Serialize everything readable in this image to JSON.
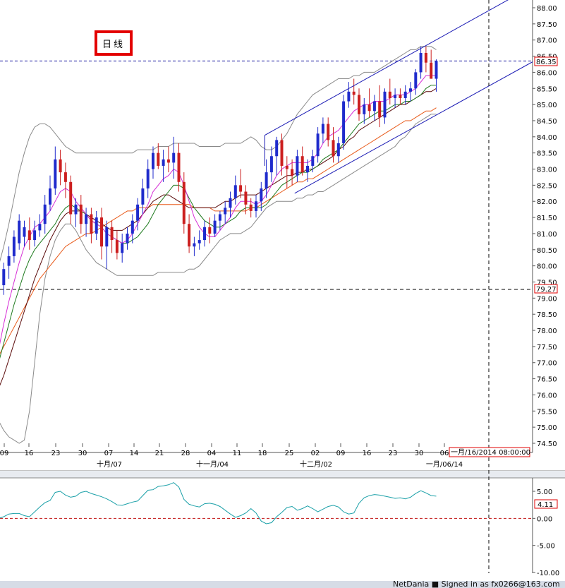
{
  "chart_title": "日线",
  "price_ref_label": "86.35",
  "low_ref_label": "79.27",
  "osc_value_label": "4.11",
  "crosshair_date_label": "一月/16/2014 08:00:00",
  "status_text": "NetDania ■  Signed in as fx0266@163.com",
  "colors": {
    "bull_candle": "#1f2bcc",
    "bear_candle": "#cc1f1f",
    "bollinger": "#8a8a8a",
    "ma_pink": "#d62cd6",
    "ma_green": "#1e7a1e",
    "ma_brown": "#5a0a0a",
    "ma_orange": "#e85a1a",
    "channel": "#1a1ab4",
    "oscillator": "#1aa0a8",
    "crosshair": "#1a1aa0"
  },
  "chart_data": {
    "type": "candlestick",
    "y_axis": {
      "min": 74.5,
      "max": 88.0,
      "ticks": [
        "88.00",
        "87.50",
        "87.00",
        "86.50",
        "86.00",
        "85.50",
        "85.00",
        "84.50",
        "84.00",
        "83.50",
        "83.00",
        "82.50",
        "82.00",
        "81.50",
        "81.00",
        "80.50",
        "80.00",
        "79.50",
        "79.00",
        "78.50",
        "78.00",
        "77.50",
        "77.00",
        "76.50",
        "76.00",
        "75.50",
        "75.00",
        "74.50"
      ]
    },
    "x_axis": {
      "day_ticks": [
        "09",
        "16",
        "23",
        "30",
        "07",
        "14",
        "21",
        "28",
        "04",
        "11",
        "18",
        "25",
        "02",
        "09",
        "16",
        "23",
        "30",
        "06"
      ],
      "month_labels": [
        "十月/07",
        "十一月/04",
        "十二月/02",
        "一月/06/14"
      ]
    },
    "candles": [
      [
        79.2,
        79.6,
        78.7,
        79.0
      ],
      [
        79.4,
        80.1,
        79.1,
        79.9
      ],
      [
        80.0,
        80.6,
        79.6,
        80.3
      ],
      [
        80.3,
        81.1,
        80.1,
        80.9
      ],
      [
        80.7,
        81.6,
        80.5,
        81.4
      ],
      [
        80.9,
        81.4,
        80.6,
        81.2
      ],
      [
        81.1,
        81.5,
        80.5,
        80.8
      ],
      [
        80.8,
        81.4,
        80.6,
        81.1
      ],
      [
        81.1,
        81.6,
        80.9,
        81.3
      ],
      [
        81.3,
        82.2,
        81.0,
        81.9
      ],
      [
        81.9,
        82.8,
        81.7,
        82.4
      ],
      [
        82.4,
        83.7,
        82.2,
        83.3
      ],
      [
        83.3,
        83.6,
        82.5,
        82.9
      ],
      [
        82.9,
        83.2,
        82.1,
        82.6
      ],
      [
        82.6,
        82.8,
        81.3,
        81.6
      ],
      [
        81.6,
        82.1,
        81.2,
        81.9
      ],
      [
        81.9,
        82.2,
        81.0,
        81.3
      ],
      [
        81.3,
        81.8,
        80.9,
        81.6
      ],
      [
        81.6,
        81.8,
        80.7,
        81.0
      ],
      [
        81.0,
        81.7,
        80.8,
        81.5
      ],
      [
        81.5,
        81.8,
        80.2,
        80.6
      ],
      [
        80.6,
        81.4,
        79.9,
        81.2
      ],
      [
        81.2,
        81.4,
        80.4,
        80.8
      ],
      [
        80.8,
        81.1,
        80.2,
        80.4
      ],
      [
        80.4,
        81.0,
        80.1,
        80.7
      ],
      [
        80.7,
        81.2,
        80.5,
        81.0
      ],
      [
        81.0,
        81.6,
        80.7,
        81.4
      ],
      [
        81.4,
        82.1,
        81.1,
        81.9
      ],
      [
        81.9,
        82.7,
        81.6,
        82.4
      ],
      [
        82.4,
        83.3,
        82.1,
        83.0
      ],
      [
        83.0,
        83.7,
        82.7,
        83.5
      ],
      [
        83.5,
        83.8,
        83.0,
        83.1
      ],
      [
        83.1,
        83.6,
        82.6,
        83.3
      ],
      [
        83.3,
        83.7,
        82.9,
        83.2
      ],
      [
        83.2,
        84.0,
        82.7,
        83.5
      ],
      [
        83.5,
        83.8,
        82.3,
        82.6
      ],
      [
        82.6,
        82.9,
        81.0,
        81.3
      ],
      [
        81.3,
        81.6,
        80.4,
        80.6
      ],
      [
        80.6,
        80.9,
        80.3,
        80.7
      ],
      [
        80.7,
        81.1,
        80.5,
        80.8
      ],
      [
        80.8,
        81.4,
        80.6,
        81.2
      ],
      [
        81.2,
        81.5,
        80.7,
        81.0
      ],
      [
        81.0,
        81.6,
        80.9,
        81.4
      ],
      [
        81.4,
        81.7,
        81.1,
        81.6
      ],
      [
        81.6,
        82.0,
        81.3,
        81.8
      ],
      [
        81.8,
        82.3,
        81.5,
        82.1
      ],
      [
        82.1,
        82.8,
        81.9,
        82.5
      ],
      [
        82.5,
        83.0,
        82.1,
        82.3
      ],
      [
        82.3,
        82.5,
        81.6,
        81.9
      ],
      [
        81.9,
        82.1,
        81.5,
        81.7
      ],
      [
        81.7,
        82.2,
        81.5,
        82.0
      ],
      [
        82.0,
        82.6,
        81.7,
        82.4
      ],
      [
        82.4,
        83.3,
        82.1,
        82.9
      ],
      [
        82.9,
        83.7,
        82.6,
        83.4
      ],
      [
        83.4,
        84.0,
        82.8,
        83.9
      ],
      [
        83.9,
        84.1,
        82.8,
        83.1
      ],
      [
        83.1,
        83.4,
        82.4,
        83.0
      ],
      [
        83.0,
        83.3,
        82.5,
        82.8
      ],
      [
        82.8,
        83.6,
        82.6,
        83.4
      ],
      [
        83.4,
        83.7,
        82.8,
        82.9
      ],
      [
        82.9,
        83.3,
        82.6,
        83.1
      ],
      [
        83.1,
        83.6,
        82.9,
        83.4
      ],
      [
        83.4,
        84.3,
        83.2,
        84.1
      ],
      [
        84.1,
        84.6,
        83.8,
        84.4
      ],
      [
        84.4,
        84.6,
        83.7,
        83.9
      ],
      [
        83.9,
        84.3,
        83.2,
        83.4
      ],
      [
        83.4,
        84.0,
        83.2,
        83.8
      ],
      [
        83.8,
        85.3,
        83.6,
        85.1
      ],
      [
        85.1,
        85.7,
        84.9,
        85.4
      ],
      [
        85.4,
        85.8,
        85.0,
        85.3
      ],
      [
        85.3,
        85.5,
        84.5,
        84.7
      ],
      [
        84.7,
        85.2,
        84.4,
        85.0
      ],
      [
        85.0,
        85.5,
        84.6,
        84.8
      ],
      [
        84.8,
        85.3,
        84.5,
        85.1
      ],
      [
        85.1,
        85.6,
        84.3,
        84.6
      ],
      [
        84.6,
        85.5,
        84.4,
        85.4
      ],
      [
        85.4,
        85.8,
        85.0,
        85.2
      ],
      [
        85.2,
        85.5,
        84.9,
        85.3
      ],
      [
        85.3,
        85.5,
        85.0,
        85.2
      ],
      [
        85.2,
        85.6,
        85.0,
        85.4
      ],
      [
        85.4,
        85.7,
        85.1,
        85.5
      ],
      [
        85.5,
        86.1,
        85.3,
        86.0
      ],
      [
        86.0,
        86.8,
        85.8,
        86.6
      ],
      [
        86.6,
        86.8,
        86.0,
        86.3
      ],
      [
        86.3,
        86.7,
        85.8,
        85.8
      ],
      [
        85.8,
        86.4,
        85.4,
        86.35
      ]
    ],
    "ma_pink": [
      77.4,
      78.2,
      78.9,
      79.5,
      80.1,
      80.6,
      80.9,
      81.2,
      81.3,
      81.5,
      81.7,
      82.0,
      82.3,
      82.4,
      82.3,
      82.0,
      81.8,
      81.6,
      81.4,
      81.3,
      81.2,
      81.0,
      80.9,
      80.8,
      80.7,
      80.8,
      81.0,
      81.3,
      81.6,
      81.9,
      82.3,
      82.5,
      82.7,
      82.8,
      83.0,
      82.9,
      82.5,
      82.0,
      81.5,
      81.2,
      81.0,
      80.9,
      80.9,
      81.1,
      81.3,
      81.5,
      81.8,
      82.0,
      82.0,
      82.0,
      81.9,
      82.0,
      82.2,
      82.5,
      82.8,
      83.0,
      83.1,
      83.2,
      83.2,
      83.2,
      83.2,
      83.3,
      83.5,
      83.8,
      84.0,
      84.1,
      84.2,
      84.4,
      84.6,
      84.8,
      84.9,
      85.0,
      85.0,
      85.1,
      85.1,
      85.1,
      85.2,
      85.3,
      85.3,
      85.3,
      85.4,
      85.5,
      85.7,
      85.9,
      85.9,
      85.9
    ],
    "ma_green": [
      77.0,
      77.6,
      78.2,
      78.8,
      79.3,
      79.8,
      80.2,
      80.5,
      80.7,
      80.9,
      81.1,
      81.3,
      81.6,
      81.8,
      81.9,
      81.8,
      81.7,
      81.6,
      81.4,
      81.3,
      81.2,
      81.0,
      80.9,
      80.8,
      80.7,
      80.7,
      80.8,
      80.9,
      81.1,
      81.3,
      81.6,
      81.9,
      82.1,
      82.3,
      82.5,
      82.5,
      82.4,
      82.1,
      81.8,
      81.6,
      81.4,
      81.3,
      81.2,
      81.2,
      81.3,
      81.4,
      81.5,
      81.7,
      81.8,
      81.8,
      81.8,
      81.8,
      81.9,
      82.1,
      82.3,
      82.5,
      82.6,
      82.7,
      82.8,
      82.9,
      82.9,
      83.0,
      83.1,
      83.3,
      83.4,
      83.5,
      83.6,
      83.8,
      84.0,
      84.2,
      84.4,
      84.5,
      84.6,
      84.7,
      84.8,
      84.8,
      84.9,
      85.0,
      85.0,
      85.1,
      85.1,
      85.2,
      85.3,
      85.5,
      85.6,
      85.6
    ],
    "ma_brown": [
      76.2,
      76.6,
      77.1,
      77.6,
      78.1,
      78.6,
      79.1,
      79.6,
      80.0,
      80.4,
      80.8,
      81.1,
      81.4,
      81.6,
      81.7,
      81.7,
      81.7,
      81.6,
      81.5,
      81.4,
      81.3,
      81.2,
      81.1,
      81.1,
      81.1,
      81.2,
      81.3,
      81.4,
      81.6,
      81.8,
      82.0,
      82.1,
      82.2,
      82.2,
      82.1,
      82.0,
      81.9,
      81.8,
      81.8,
      81.8,
      81.8,
      81.8,
      81.8,
      81.9,
      82.0,
      82.0,
      82.1,
      82.2,
      82.2,
      82.2,
      82.2,
      82.3,
      82.4,
      82.5,
      82.6,
      82.7,
      82.8,
      82.8,
      82.9,
      82.9,
      83.0,
      83.0,
      83.1,
      83.2,
      83.3,
      83.4,
      83.6,
      83.7,
      83.9,
      84.0,
      84.2,
      84.3,
      84.4,
      84.5,
      84.6,
      84.7,
      84.8,
      84.9,
      85.0,
      85.0,
      85.1,
      85.2,
      85.3,
      85.4,
      85.4,
      85.5
    ],
    "ma_orange": [
      77.2,
      77.5,
      77.8,
      78.1,
      78.4,
      78.7,
      79.0,
      79.3,
      79.6,
      79.8,
      80.0,
      80.2,
      80.4,
      80.6,
      80.7,
      80.8,
      80.9,
      81.0,
      81.0,
      81.1,
      81.2,
      81.3,
      81.4,
      81.5,
      81.6,
      81.7,
      81.7,
      81.8,
      81.8,
      81.8,
      81.9,
      81.9,
      81.9,
      81.9,
      81.9,
      81.9,
      81.9,
      81.9,
      81.8,
      81.8,
      81.8,
      81.8,
      81.7,
      81.7,
      81.7,
      81.7,
      81.7,
      81.7,
      81.7,
      81.8,
      81.8,
      81.9,
      82.0,
      82.1,
      82.2,
      82.3,
      82.4,
      82.5,
      82.6,
      82.6,
      82.7,
      82.7,
      82.8,
      82.9,
      83.0,
      83.1,
      83.2,
      83.3,
      83.4,
      83.5,
      83.6,
      83.7,
      83.8,
      83.9,
      84.0,
      84.1,
      84.2,
      84.3,
      84.4,
      84.5,
      84.5,
      84.6,
      84.7,
      84.8,
      84.8,
      84.9
    ],
    "bb_upper": [
      80.0,
      80.6,
      81.3,
      82.1,
      82.9,
      83.5,
      84.0,
      84.3,
      84.4,
      84.4,
      84.3,
      84.1,
      83.9,
      83.7,
      83.6,
      83.5,
      83.5,
      83.5,
      83.5,
      83.5,
      83.5,
      83.5,
      83.5,
      83.5,
      83.5,
      83.5,
      83.5,
      83.6,
      83.6,
      83.6,
      83.6,
      83.7,
      83.7,
      83.7,
      83.8,
      83.8,
      83.8,
      83.8,
      83.8,
      83.7,
      83.7,
      83.7,
      83.7,
      83.7,
      83.8,
      83.8,
      83.8,
      83.8,
      83.9,
      84.0,
      83.9,
      83.7,
      83.6,
      83.6,
      83.7,
      83.9,
      84.1,
      84.4,
      84.7,
      84.9,
      85.1,
      85.3,
      85.4,
      85.5,
      85.6,
      85.7,
      85.8,
      85.8,
      85.8,
      85.9,
      85.9,
      86.0,
      86.0,
      86.0,
      86.1,
      86.2,
      86.3,
      86.4,
      86.5,
      86.6,
      86.7,
      86.7,
      86.8,
      86.8,
      86.8,
      86.7
    ],
    "bb_lower": [
      75.2,
      74.9,
      74.7,
      74.6,
      74.5,
      74.6,
      75.5,
      77.0,
      78.5,
      79.6,
      80.3,
      80.8,
      81.1,
      81.3,
      81.3,
      81.1,
      80.8,
      80.5,
      80.3,
      80.1,
      80.0,
      79.9,
      79.8,
      79.7,
      79.7,
      79.7,
      79.7,
      79.7,
      79.7,
      79.7,
      79.7,
      79.8,
      79.8,
      79.8,
      79.8,
      79.8,
      79.8,
      79.9,
      79.9,
      80.0,
      80.2,
      80.4,
      80.6,
      80.8,
      80.9,
      81.0,
      81.0,
      81.0,
      81.1,
      81.2,
      81.4,
      81.6,
      81.8,
      81.9,
      82.0,
      82.0,
      82.0,
      82.0,
      82.1,
      82.1,
      82.2,
      82.2,
      82.3,
      82.3,
      82.4,
      82.5,
      82.6,
      82.7,
      82.8,
      82.9,
      83.0,
      83.1,
      83.2,
      83.3,
      83.4,
      83.5,
      83.6,
      83.7,
      83.9,
      84.0,
      84.2,
      84.4,
      84.5,
      84.6,
      84.7,
      84.7
    ],
    "oscillator": {
      "ticks": [
        "5.00",
        "0.00",
        "-5.00",
        "-10.00"
      ],
      "min": -10,
      "max": 8,
      "values": [
        0.0,
        0.3,
        0.8,
        0.9,
        0.9,
        0.5,
        0.3,
        1.2,
        2.1,
        2.9,
        3.3,
        4.8,
        5.0,
        4.3,
        3.9,
        4.1,
        4.8,
        5.0,
        4.6,
        4.3,
        4.0,
        3.6,
        3.1,
        2.5,
        2.4,
        2.7,
        3.0,
        3.2,
        4.2,
        5.2,
        5.3,
        5.9,
        6.0,
        6.2,
        6.6,
        5.8,
        3.5,
        2.6,
        2.3,
        2.1,
        2.7,
        2.8,
        2.6,
        2.2,
        1.5,
        0.8,
        0.2,
        0.5,
        1.0,
        1.8,
        1.0,
        -0.5,
        -1.0,
        -0.8,
        0.3,
        1.1,
        2.0,
        2.2,
        1.5,
        1.8,
        2.3,
        1.8,
        1.2,
        1.7,
        2.2,
        2.4,
        2.1,
        1.2,
        0.8,
        1.0,
        2.8,
        3.8,
        4.2,
        4.4,
        4.3,
        4.1,
        3.9,
        3.7,
        3.8,
        3.6,
        3.9,
        4.6,
        5.1,
        4.7,
        4.2,
        4.1
      ]
    }
  }
}
